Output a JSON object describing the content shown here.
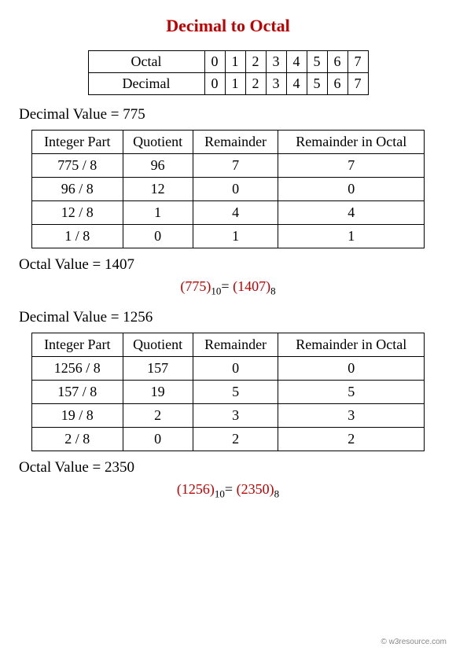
{
  "title": "Decimal to Octal",
  "digit_table": {
    "rows": [
      {
        "label": "Octal",
        "cells": [
          "0",
          "1",
          "2",
          "3",
          "4",
          "5",
          "6",
          "7"
        ]
      },
      {
        "label": "Decimal",
        "cells": [
          "0",
          "1",
          "2",
          "3",
          "4",
          "5",
          "6",
          "7"
        ]
      }
    ]
  },
  "conv_headers": [
    "Integer Part",
    "Quotient",
    "Remainder",
    "Remainder  in Octal"
  ],
  "examples": [
    {
      "decimal_label": "Decimal Value  =   775",
      "octal_label": "Octal Value  =   1407",
      "rows": [
        {
          "ip": "775 / 8",
          "q": "96",
          "r": "7",
          "ro": "7"
        },
        {
          "ip": "96 / 8",
          "q": "12",
          "r": "0",
          "ro": "0"
        },
        {
          "ip": "12 / 8",
          "q": "1",
          "r": "4",
          "ro": "4"
        },
        {
          "ip": "1 / 8",
          "q": "0",
          "r": "1",
          "ro": "1"
        }
      ],
      "eq": {
        "lhs": "775",
        "lbase": "10",
        "rhs": "1407",
        "rbase": "8"
      }
    },
    {
      "decimal_label": "Decimal Value  =   1256",
      "octal_label": "Octal Value  =   2350",
      "rows": [
        {
          "ip": "1256 / 8",
          "q": "157",
          "r": "0",
          "ro": "0"
        },
        {
          "ip": "157 / 8",
          "q": "19",
          "r": "5",
          "ro": "5"
        },
        {
          "ip": "19 / 8",
          "q": "2",
          "r": "3",
          "ro": "3"
        },
        {
          "ip": "2 / 8",
          "q": "0",
          "r": "2",
          "ro": "2"
        }
      ],
      "eq": {
        "lhs": "1256",
        "lbase": "10",
        "rhs": "2350",
        "rbase": "8"
      }
    }
  ],
  "watermark": "© w3resource.com",
  "chart_data": {
    "type": "table",
    "title": "Decimal to Octal conversion by repeated division",
    "examples": [
      {
        "decimal": 775,
        "octal": "1407",
        "steps": [
          [
            775,
            96,
            7
          ],
          [
            96,
            12,
            0
          ],
          [
            12,
            1,
            4
          ],
          [
            1,
            0,
            1
          ]
        ]
      },
      {
        "decimal": 1256,
        "octal": "2350",
        "steps": [
          [
            1256,
            157,
            0
          ],
          [
            157,
            19,
            5
          ],
          [
            19,
            2,
            3
          ],
          [
            2,
            0,
            2
          ]
        ]
      }
    ]
  }
}
